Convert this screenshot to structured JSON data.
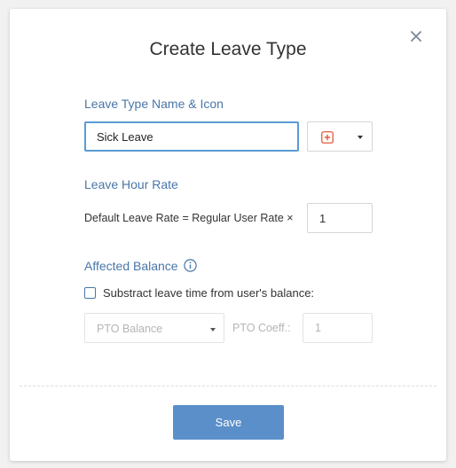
{
  "dialog": {
    "title": "Create Leave Type"
  },
  "leave_type": {
    "section_label": "Leave Type Name & Icon",
    "name_value": "Sick Leave",
    "icon_name": "medical-cross-icon",
    "icon_color": "#e05a3c"
  },
  "leave_rate": {
    "section_label": "Leave Hour Rate",
    "formula_text": "Default Leave Rate = Regular User Rate  ×",
    "rate_value": "1"
  },
  "balance": {
    "section_label": "Affected Balance",
    "checkbox_label": "Substract leave time from user's balance:",
    "checkbox_checked": false,
    "balance_select_value": "PTO Balance",
    "coeff_label": "PTO Coeff.:",
    "coeff_value": "1"
  },
  "footer": {
    "save_label": "Save"
  },
  "colors": {
    "accent": "#4a76a8",
    "button": "#5b8fc9",
    "input_focus": "#5b9bd5"
  }
}
